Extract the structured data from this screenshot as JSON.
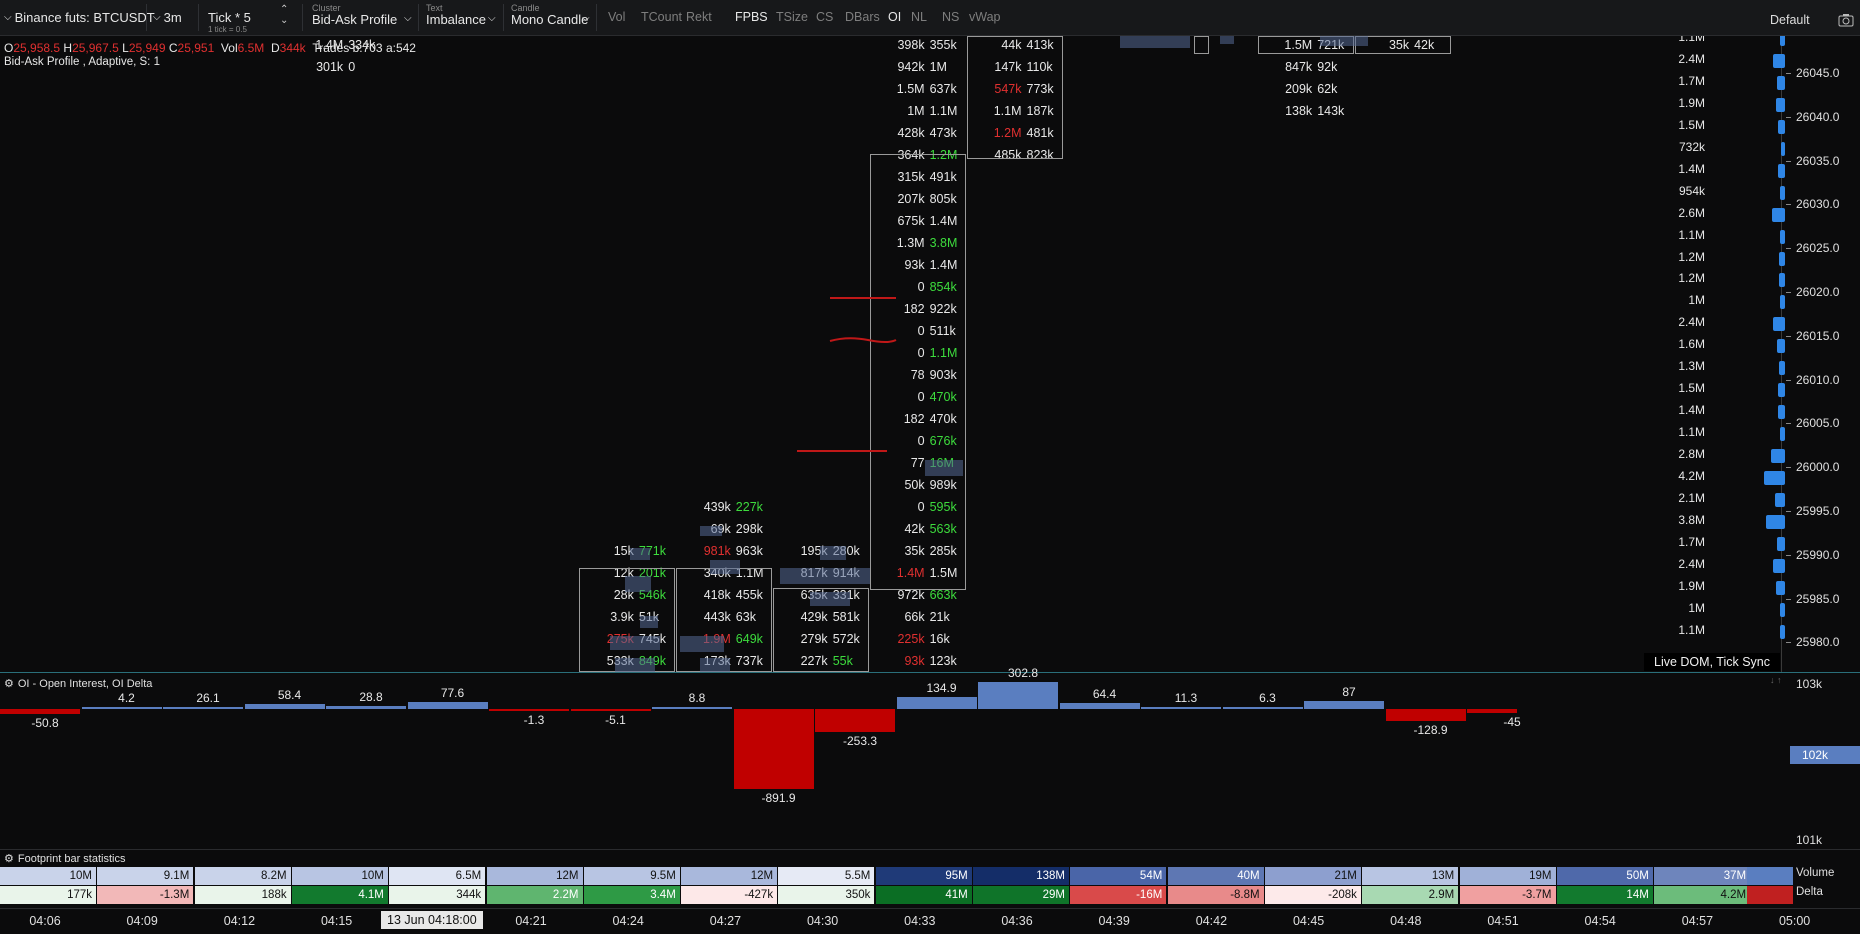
{
  "toolbar": {
    "symbol": "Binance futs: BTCUSDT",
    "timeframe": "3m",
    "tick": {
      "label": "Tick * 5",
      "sub": "1 tick = 0.5"
    },
    "cluster": {
      "caption": "Cluster",
      "value": "Bid-Ask Profile"
    },
    "text": {
      "caption": "Text",
      "value": "Imbalance"
    },
    "candle": {
      "caption": "Candle",
      "value": "Mono Candle"
    },
    "toggles": [
      {
        "label": "Vol",
        "on": false
      },
      {
        "label": "TCount",
        "on": false
      },
      {
        "label": "Rekt",
        "on": false
      },
      {
        "label": "FPBS",
        "on": true
      },
      {
        "label": "TSize",
        "on": false
      },
      {
        "label": "CS",
        "on": false
      },
      {
        "label": "DBars",
        "on": false
      },
      {
        "label": "OI",
        "on": true
      },
      {
        "label": "NL",
        "on": false
      },
      {
        "label": "NS",
        "on": false
      },
      {
        "label": "vWap",
        "on": false
      }
    ],
    "template": "Default"
  },
  "info": {
    "o_label": "O",
    "o": "25,958.5",
    "h_label": "H",
    "h": "25,967.5",
    "l_label": "L",
    "l": "25,949",
    "c_label": "C",
    "c": "25,951",
    "vol_label": "Vol",
    "vol": "6.5M",
    "d_label": "D",
    "d": "344k",
    "trades": "Trades b:703 a:542",
    "profile": "Bid-Ask Profile , Adaptive, S: 1"
  },
  "colors": {
    "bid_neg": "#e03030",
    "ask_pos": "#3ddc3d",
    "oi_pos": "#5a7ec0",
    "oi_neg": "#c00000",
    "dom": "#2f86e6"
  },
  "price_axis": [
    "26045.0",
    "26040.0",
    "26035.0",
    "26030.0",
    "26025.0",
    "26020.0",
    "26015.0",
    "26010.0",
    "26005.0",
    "26000.0",
    "25995.0",
    "25990.0",
    "25985.0",
    "25980.0"
  ],
  "dom_volumes": [
    "1.1M",
    "2.4M",
    "1.7M",
    "1.9M",
    "1.5M",
    "732k",
    "1.4M",
    "954k",
    "2.6M",
    "1.1M",
    "1.2M",
    "1.2M",
    "1M",
    "2.4M",
    "1.6M",
    "1.3M",
    "1.5M",
    "1.4M",
    "1.1M",
    "2.8M",
    "4.2M",
    "2.1M",
    "3.8M",
    "1.7M",
    "2.4M",
    "1.9M",
    "1M",
    "1.1M"
  ],
  "live_dom_label": "Live DOM, Tick Sync",
  "footprints": [
    {
      "col": 3,
      "rows": [
        {
          "row": 0,
          "bid": "1.4M",
          "ask": "334k"
        },
        {
          "row": 1,
          "bid": "301k",
          "ask": "0"
        }
      ]
    },
    {
      "col": 6,
      "rows": [
        {
          "row": 23,
          "bid": "15k",
          "ask": "771k",
          "ac": "g"
        },
        {
          "row": 24,
          "bid": "12k",
          "ask": "201k",
          "ac": "g"
        },
        {
          "row": 25,
          "bid": "28k",
          "ask": "546k",
          "ac": "g"
        },
        {
          "row": 26,
          "bid": "3.9k",
          "ask": "51k"
        },
        {
          "row": 27,
          "bid": "275k",
          "bc": "r",
          "ask": "745k"
        },
        {
          "row": 28,
          "bid": "533k",
          "ask": "849k",
          "ac": "g"
        }
      ]
    },
    {
      "col": 7,
      "rows": [
        {
          "row": 21,
          "bid": "439k",
          "ask": "227k",
          "ac": "g"
        },
        {
          "row": 22,
          "bid": "69k",
          "ask": "298k"
        },
        {
          "row": 23,
          "bid": "981k",
          "bc": "r",
          "ask": "963k"
        },
        {
          "row": 24,
          "bid": "340k",
          "ask": "1.1M"
        },
        {
          "row": 25,
          "bid": "418k",
          "ask": "455k"
        },
        {
          "row": 26,
          "bid": "443k",
          "ask": "63k"
        },
        {
          "row": 27,
          "bid": "1.9M",
          "bc": "r",
          "ask": "649k",
          "ac": "g"
        },
        {
          "row": 28,
          "bid": "173k",
          "ask": "737k"
        }
      ]
    },
    {
      "col": 8,
      "rows": [
        {
          "row": 23,
          "bid": "195k",
          "ask": "280k"
        },
        {
          "row": 24,
          "bid": "817k",
          "ask": "914k"
        },
        {
          "row": 25,
          "bid": "635k",
          "ask": "331k"
        },
        {
          "row": 26,
          "bid": "429k",
          "ask": "581k"
        },
        {
          "row": 27,
          "bid": "279k",
          "ask": "572k"
        },
        {
          "row": 28,
          "bid": "227k",
          "ask": "55k",
          "ac": "g"
        }
      ]
    },
    {
      "col": 9,
      "rows": [
        {
          "row": 0,
          "bid": "398k",
          "ask": "355k"
        },
        {
          "row": 1,
          "bid": "942k",
          "ask": "1M"
        },
        {
          "row": 2,
          "bid": "1.5M",
          "ask": "637k"
        },
        {
          "row": 3,
          "bid": "1M",
          "ask": "1.1M"
        },
        {
          "row": 4,
          "bid": "428k",
          "ask": "473k"
        },
        {
          "row": 5,
          "bid": "364k",
          "ask": "1.2M",
          "ac": "g"
        },
        {
          "row": 6,
          "bid": "315k",
          "ask": "491k"
        },
        {
          "row": 7,
          "bid": "207k",
          "ask": "805k"
        },
        {
          "row": 8,
          "bid": "675k",
          "ask": "1.4M"
        },
        {
          "row": 9,
          "bid": "1.3M",
          "ask": "3.8M",
          "ac": "g"
        },
        {
          "row": 10,
          "bid": "93k",
          "ask": "1.4M"
        },
        {
          "row": 11,
          "bid": "0",
          "ask": "854k",
          "ac": "g"
        },
        {
          "row": 12,
          "bid": "182",
          "ask": "922k"
        },
        {
          "row": 13,
          "bid": "0",
          "ask": "511k"
        },
        {
          "row": 14,
          "bid": "0",
          "ask": "1.1M",
          "ac": "g"
        },
        {
          "row": 15,
          "bid": "78",
          "ask": "903k"
        },
        {
          "row": 16,
          "bid": "0",
          "ask": "470k",
          "ac": "g"
        },
        {
          "row": 17,
          "bid": "182",
          "ask": "470k"
        },
        {
          "row": 18,
          "bid": "0",
          "ask": "676k",
          "ac": "g"
        },
        {
          "row": 19,
          "bid": "77",
          "ask": "16M",
          "ac": "g"
        },
        {
          "row": 20,
          "bid": "50k",
          "ask": "989k"
        },
        {
          "row": 21,
          "bid": "0",
          "ask": "595k",
          "ac": "g"
        },
        {
          "row": 22,
          "bid": "42k",
          "ask": "563k",
          "ac": "g"
        },
        {
          "row": 23,
          "bid": "35k",
          "ask": "285k"
        },
        {
          "row": 24,
          "bid": "1.4M",
          "bc": "r",
          "ask": "1.5M"
        },
        {
          "row": 25,
          "bid": "972k",
          "ask": "663k",
          "ac": "g"
        },
        {
          "row": 26,
          "bid": "66k",
          "ask": "21k"
        },
        {
          "row": 27,
          "bid": "225k",
          "bc": "r",
          "ask": "16k"
        },
        {
          "row": 28,
          "bid": "93k",
          "bc": "r",
          "ask": "123k"
        }
      ]
    },
    {
      "col": 10,
      "rows": [
        {
          "row": 0,
          "bid": "44k",
          "ask": "413k"
        },
        {
          "row": 1,
          "bid": "147k",
          "ask": "110k"
        },
        {
          "row": 2,
          "bid": "547k",
          "bc": "r",
          "ask": "773k"
        },
        {
          "row": 3,
          "bid": "1.1M",
          "ask": "187k"
        },
        {
          "row": 4,
          "bid": "1.2M",
          "bc": "r",
          "ask": "481k"
        },
        {
          "row": 5,
          "bid": "485k",
          "ask": "823k"
        }
      ]
    },
    {
      "col": 13,
      "rows": [
        {
          "row": 0,
          "bid": "1.5M",
          "ask": "721k"
        },
        {
          "row": 1,
          "bid": "847k",
          "ask": "92k"
        },
        {
          "row": 2,
          "bid": "209k",
          "ask": "62k"
        },
        {
          "row": 3,
          "bid": "138k",
          "ask": "143k"
        }
      ]
    },
    {
      "col": 14,
      "rows": [
        {
          "row": 0,
          "bid": "35k",
          "ask": "42k"
        }
      ]
    }
  ],
  "oi_panel": {
    "title": "OI - Open Interest, OI Delta",
    "deltas": [
      -50.8,
      4.2,
      26.1,
      58.4,
      28.8,
      77.6,
      -1.3,
      -5.1,
      8.8,
      -891.9,
      -253.3,
      134.9,
      302.8,
      64.4,
      11.3,
      6.3,
      87,
      -128.9,
      -45
    ],
    "labels": [
      "-50.8",
      "4.2",
      "26.1",
      "58.4",
      "28.8",
      "77.6",
      "-1.3",
      "-5.1",
      "8.8",
      "-891.9",
      "-253.3",
      "134.9",
      "302.8",
      "64.4",
      "11.3",
      "6.3",
      "87",
      "-128.9",
      "-45"
    ],
    "axis_top": "103k",
    "axis_bottom": "101k",
    "current": "102k"
  },
  "stats": {
    "title": "Footprint bar statistics",
    "volume_label": "Volume",
    "delta_label": "Delta",
    "volume": [
      "10M",
      "9.1M",
      "8.2M",
      "10M",
      "6.5M",
      "12M",
      "9.5M",
      "12M",
      "5.5M",
      "95M",
      "138M",
      "54M",
      "40M",
      "21M",
      "13M",
      "19M",
      "50M",
      "37M"
    ],
    "delta": [
      "177k",
      "-1.3M",
      "188k",
      "4.1M",
      "344k",
      "2.2M",
      "3.4M",
      "-427k",
      "350k",
      "41M",
      "29M",
      "-16M",
      "-8.8M",
      "-208k",
      "2.9M",
      "-3.7M",
      "14M",
      "4.2M"
    ],
    "volume_colors": [
      "#c9d3ea",
      "#c9d3ea",
      "#c9d3ea",
      "#b8c5e3",
      "#dfe5f3",
      "#a9b8dc",
      "#b8c5e3",
      "#a9b8dc",
      "#e6eaf5",
      "#1f3a78",
      "#142d68",
      "#4a65a8",
      "#5e77b3",
      "#8d9fcf",
      "#b8c5e3",
      "#a0b1d8",
      "#4f69aa",
      "#6e85bc"
    ],
    "delta_colors": [
      "#e9f4ea",
      "#f2b8b8",
      "#e9f4ea",
      "#127a2e",
      "#e9f4ea",
      "#5fb56f",
      "#2e9a45",
      "#fde8e8",
      "#e9f4ea",
      "#0b6e24",
      "#0f7429",
      "#d94a4a",
      "#e88a8a",
      "#fdeaea",
      "#a8d9b2",
      "#f0a0a0",
      "#127a2e",
      "#6cbc7b"
    ]
  },
  "time_axis": [
    "04:06",
    "04:09",
    "04:12",
    "04:15",
    "04:18",
    "04:21",
    "04:24",
    "04:27",
    "04:30",
    "04:33",
    "04:36",
    "04:39",
    "04:42",
    "04:45",
    "04:48",
    "04:51",
    "04:54",
    "04:57",
    "05:00"
  ],
  "cursor_time": "13 Jun 04:18:00"
}
